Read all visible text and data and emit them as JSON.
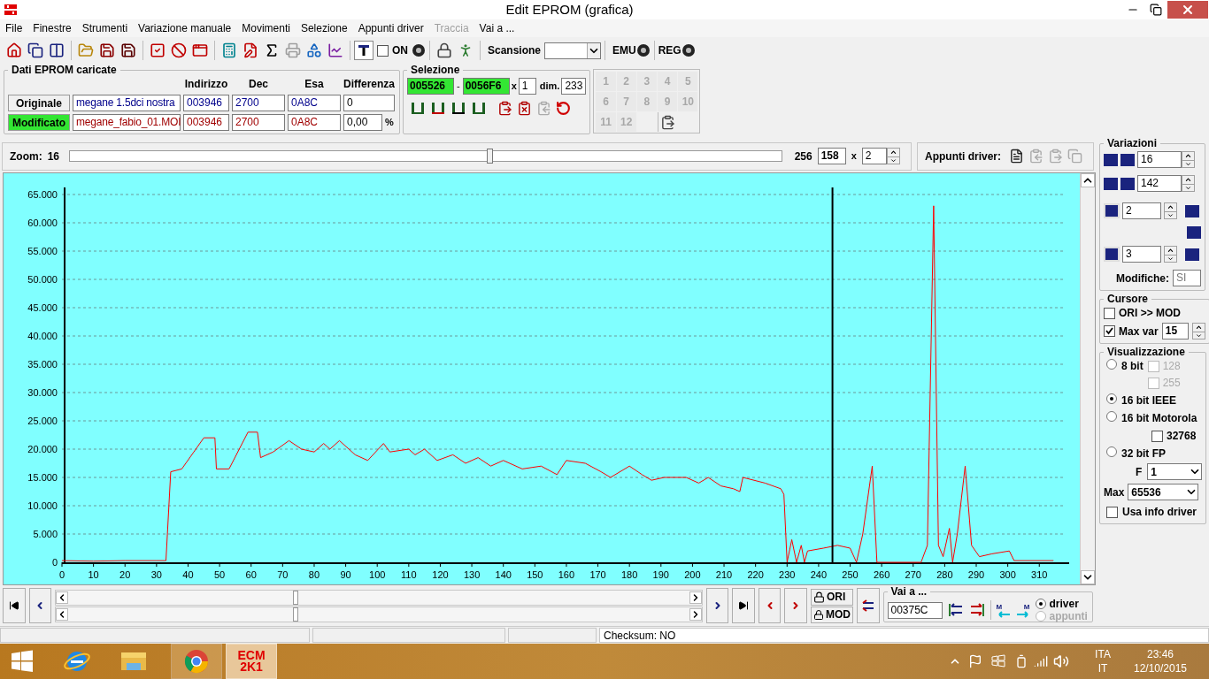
{
  "window": {
    "title": "Edit EPROM (grafica)"
  },
  "menu": [
    {
      "label": "File",
      "disabled": false
    },
    {
      "label": "Finestre",
      "disabled": false
    },
    {
      "label": "Strumenti",
      "disabled": false
    },
    {
      "label": "Variazione manuale",
      "disabled": false
    },
    {
      "label": "Movimenti",
      "disabled": false
    },
    {
      "label": "Selezione",
      "disabled": false
    },
    {
      "label": "Appunti driver",
      "disabled": false
    },
    {
      "label": "Traccia",
      "disabled": true
    },
    {
      "label": "Vai a ...",
      "disabled": false
    }
  ],
  "toolbar": {
    "on_toggle": {
      "label": "ON",
      "checked": false
    },
    "scan_label": "Scansione",
    "emu_label": "EMU",
    "reg_label": "REG"
  },
  "eprom_data": {
    "title": "Dati EPROM caricate",
    "columns": [
      "Indirizzo",
      "Dec",
      "Esa",
      "Differenza"
    ],
    "rows": [
      {
        "label": "Originale",
        "selected": false,
        "color": "#00008b",
        "file": "megane 1.5dci nostra",
        "address": "003946",
        "dec": "2700",
        "hex": "0A8C",
        "difference": "0"
      },
      {
        "label": "Modificato",
        "selected": true,
        "color": "#a00000",
        "file": "megane_fabio_01.MOI",
        "address": "003946",
        "dec": "2700",
        "hex": "0A8C",
        "difference": "0,00",
        "unit": "%"
      }
    ]
  },
  "selection": {
    "title": "Selezione",
    "start": "005526",
    "separator": "-",
    "end": "0056F6",
    "x_label": "x",
    "multiplier": "1",
    "dim_label": "dim.",
    "dim": "233"
  },
  "slots": [
    {
      "label": "1",
      "disabled": true
    },
    {
      "label": "2",
      "disabled": true
    },
    {
      "label": "3",
      "disabled": true
    },
    {
      "label": "4",
      "disabled": true
    },
    {
      "label": "5",
      "disabled": true
    },
    {
      "label": "6",
      "disabled": true
    },
    {
      "label": "7",
      "disabled": true
    },
    {
      "label": "8",
      "disabled": true
    },
    {
      "label": "9",
      "disabled": true
    },
    {
      "label": "10",
      "disabled": true
    },
    {
      "label": "11",
      "disabled": true
    },
    {
      "label": "12",
      "disabled": true
    }
  ],
  "zoom": {
    "label": "Zoom:",
    "min": "16",
    "max": "256",
    "level": 0.59,
    "value": "158",
    "x_label": "x",
    "factor": "2"
  },
  "clipboard": {
    "label": "Appunti driver:"
  },
  "chart": {
    "chart_data": {
      "type": "line",
      "xlim": [
        0,
        322
      ],
      "ylim": [
        0,
        65
      ],
      "xticks": [
        0,
        10,
        20,
        30,
        40,
        50,
        60,
        70,
        80,
        90,
        100,
        110,
        120,
        130,
        140,
        150,
        160,
        170,
        180,
        190,
        200,
        210,
        220,
        230,
        240,
        250,
        260,
        270,
        280,
        290,
        300,
        310
      ],
      "yticks": [
        {
          "value": 0,
          "label": "0"
        },
        {
          "value": 5,
          "label": "5.000"
        },
        {
          "value": 10,
          "label": "10.000"
        },
        {
          "value": 15,
          "label": "15.000"
        },
        {
          "value": 20,
          "label": "20.000"
        },
        {
          "value": 25,
          "label": "25.000"
        },
        {
          "value": 30,
          "label": "30.000"
        },
        {
          "value": 35,
          "label": "35.000"
        },
        {
          "value": 40,
          "label": "40.000"
        },
        {
          "value": 45,
          "label": "45.000"
        },
        {
          "value": 50,
          "label": "50.000"
        },
        {
          "value": 55,
          "label": "55.000"
        },
        {
          "value": 60,
          "label": "60.000"
        },
        {
          "value": 65,
          "label": "65.000"
        }
      ],
      "x": [
        0,
        10,
        20,
        30,
        33,
        34.5,
        38,
        45,
        48.5,
        49,
        53,
        59,
        62,
        63,
        67,
        72,
        76,
        80,
        83,
        85,
        88,
        93,
        97,
        102,
        104,
        110,
        112,
        115,
        119,
        124,
        128,
        132,
        136,
        140,
        146,
        152,
        157,
        160,
        166,
        171,
        174,
        180,
        184,
        187,
        191,
        198,
        202,
        205,
        209,
        213,
        215,
        216,
        223,
        228,
        229,
        230,
        231.5,
        233,
        234.5,
        235.5,
        236.5,
        241.5,
        246,
        250,
        252,
        254,
        257,
        258.5,
        272.5,
        274.5,
        276.5,
        278,
        279.5,
        281.5,
        282.5,
        284,
        286.5,
        288.5,
        291,
        295,
        300.5,
        302,
        314.5
      ],
      "series": [
        {
          "color": "#ff0000",
          "values": [
            0.3,
            0.2,
            0.3,
            0.3,
            0.3,
            16,
            16.5,
            22,
            22,
            16.5,
            16.5,
            23,
            23,
            18.5,
            19.5,
            21.5,
            20,
            19.5,
            21,
            20,
            21.5,
            19,
            18,
            21,
            19.5,
            20,
            19,
            20,
            18,
            19,
            17.5,
            18.5,
            17,
            18,
            16.5,
            17,
            15.5,
            18,
            17.5,
            16,
            15,
            17,
            15.5,
            14.5,
            15,
            15,
            14,
            15,
            13.5,
            13,
            12.5,
            15,
            14,
            13,
            12,
            0,
            4,
            0,
            3,
            0,
            2,
            2.5,
            3,
            2.5,
            0,
            5,
            17,
            0,
            0,
            3,
            63,
            3,
            1,
            6,
            0,
            5,
            17,
            3,
            1,
            1.5,
            2,
            0.3,
            0.3
          ]
        }
      ],
      "grid": true,
      "ref_lines": [
        {
          "axis": "x",
          "value": 244.4
        }
      ]
    }
  },
  "variations": {
    "title": "Variazioni",
    "small_step": "16",
    "large_step": "142",
    "a_value": "2",
    "p_value": "3",
    "changes_label": "Modifiche:",
    "changes": "SI"
  },
  "cursor": {
    "title": "Cursore",
    "options": [
      {
        "label": "ORI >> MOD",
        "checked": false
      },
      {
        "label": "Max var",
        "checked": true,
        "value": "15"
      }
    ]
  },
  "display": {
    "title": "Visualizzazione",
    "modes": [
      {
        "label": "8 bit",
        "selected": false
      },
      {
        "label": "16 bit IEEE",
        "selected": true
      },
      {
        "label": "16 bit Motorola",
        "selected": false
      },
      {
        "label": "32 bit FP",
        "selected": false
      }
    ],
    "checks_8bit": [
      {
        "label": "128",
        "checked": false,
        "disabled": true
      },
      {
        "label": "255",
        "checked": false,
        "disabled": true
      }
    ],
    "check_motorola": {
      "label": "32768",
      "checked": false,
      "disabled": false
    },
    "f_label": "F",
    "f_value": "1",
    "max_label": "Max",
    "max_value": "65536",
    "use_driver_info": {
      "label": "Usa info driver",
      "checked": false
    }
  },
  "bottom": {
    "ori_label": "ORI",
    "mod_label": "MOD",
    "goto": {
      "title": "Vai a ...",
      "value": "00375C"
    },
    "m_left": "M",
    "m_right": "M",
    "sources": [
      {
        "label": "driver",
        "selected": true,
        "disabled": false
      },
      {
        "label": "appunti",
        "selected": false,
        "disabled": true
      }
    ]
  },
  "status_bar": {
    "checksum": "Checksum: NO"
  },
  "taskbar": {
    "logo_lines": [
      "ECM",
      "2K1"
    ],
    "language": "ITA",
    "layout": "IT",
    "time": "23:46",
    "date": "12/10/2015"
  }
}
